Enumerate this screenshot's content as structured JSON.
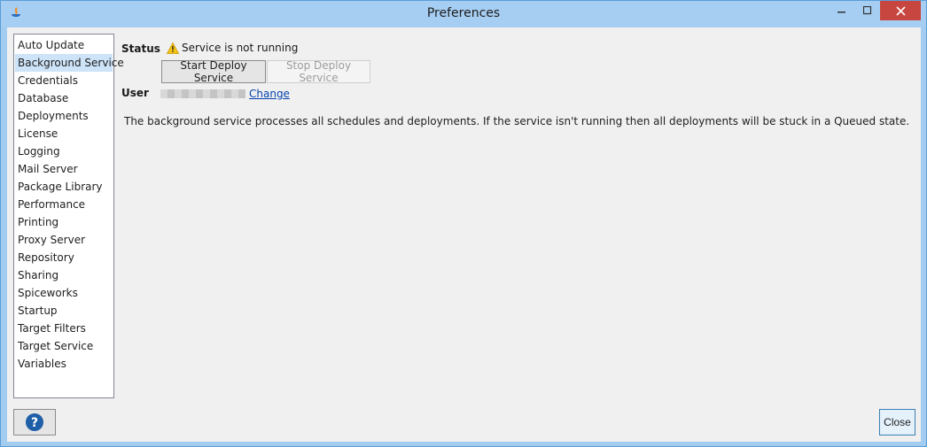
{
  "window": {
    "title": "Preferences"
  },
  "sidebar": {
    "items": [
      {
        "label": "Auto Update"
      },
      {
        "label": "Background Service"
      },
      {
        "label": "Credentials"
      },
      {
        "label": "Database"
      },
      {
        "label": "Deployments"
      },
      {
        "label": "License"
      },
      {
        "label": "Logging"
      },
      {
        "label": "Mail Server"
      },
      {
        "label": "Package Library"
      },
      {
        "label": "Performance"
      },
      {
        "label": "Printing"
      },
      {
        "label": "Proxy Server"
      },
      {
        "label": "Repository"
      },
      {
        "label": "Sharing"
      },
      {
        "label": "Spiceworks"
      },
      {
        "label": "Startup"
      },
      {
        "label": "Target Filters"
      },
      {
        "label": "Target Service"
      },
      {
        "label": "Variables"
      }
    ],
    "selected": "Background Service"
  },
  "main": {
    "status_label": "Status",
    "status_text": "Service is not running",
    "start_button": "Start Deploy Service",
    "stop_button": "Stop Deploy Service",
    "user_label": "User",
    "change_link": "Change",
    "description": "The background service processes all schedules and deployments. If the service isn't running then all deployments will be stuck in a Queued state."
  },
  "footer": {
    "help_icon": "question-mark-icon",
    "close_button": "Close"
  },
  "colors": {
    "selection": "#cde3f7",
    "close_red": "#c7463f",
    "warning": "#f5c518",
    "help_blue": "#1f5fa8"
  }
}
